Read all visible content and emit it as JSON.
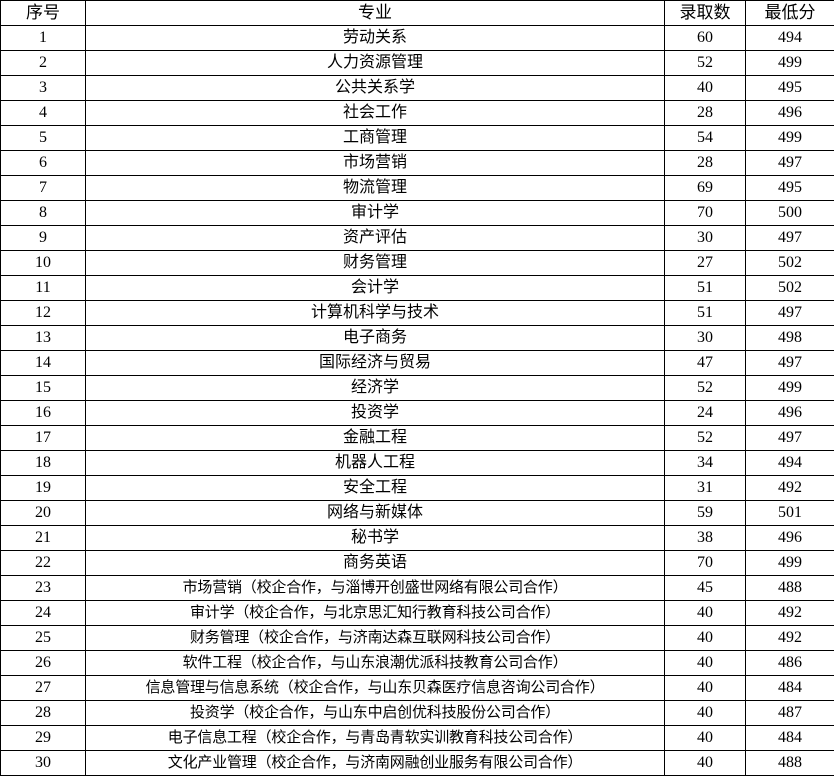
{
  "table": {
    "name": "admissions-results-table",
    "columns": [
      {
        "key": "index",
        "label": "序号"
      },
      {
        "key": "major",
        "label": "专业"
      },
      {
        "key": "count",
        "label": "录取数"
      },
      {
        "key": "score",
        "label": "最低分"
      }
    ],
    "rows": [
      {
        "index": "1",
        "major": "劳动关系",
        "count": "60",
        "score": "494"
      },
      {
        "index": "2",
        "major": "人力资源管理",
        "count": "52",
        "score": "499"
      },
      {
        "index": "3",
        "major": "公共关系学",
        "count": "40",
        "score": "495"
      },
      {
        "index": "4",
        "major": "社会工作",
        "count": "28",
        "score": "496"
      },
      {
        "index": "5",
        "major": "工商管理",
        "count": "54",
        "score": "499"
      },
      {
        "index": "6",
        "major": "市场营销",
        "count": "28",
        "score": "497"
      },
      {
        "index": "7",
        "major": "物流管理",
        "count": "69",
        "score": "495"
      },
      {
        "index": "8",
        "major": "审计学",
        "count": "70",
        "score": "500"
      },
      {
        "index": "9",
        "major": "资产评估",
        "count": "30",
        "score": "497"
      },
      {
        "index": "10",
        "major": "财务管理",
        "count": "27",
        "score": "502"
      },
      {
        "index": "11",
        "major": "会计学",
        "count": "51",
        "score": "502"
      },
      {
        "index": "12",
        "major": "计算机科学与技术",
        "count": "51",
        "score": "497"
      },
      {
        "index": "13",
        "major": "电子商务",
        "count": "30",
        "score": "498"
      },
      {
        "index": "14",
        "major": "国际经济与贸易",
        "count": "47",
        "score": "497"
      },
      {
        "index": "15",
        "major": "经济学",
        "count": "52",
        "score": "499"
      },
      {
        "index": "16",
        "major": "投资学",
        "count": "24",
        "score": "496"
      },
      {
        "index": "17",
        "major": "金融工程",
        "count": "52",
        "score": "497"
      },
      {
        "index": "18",
        "major": "机器人工程",
        "count": "34",
        "score": "494"
      },
      {
        "index": "19",
        "major": "安全工程",
        "count": "31",
        "score": "492"
      },
      {
        "index": "20",
        "major": "网络与新媒体",
        "count": "59",
        "score": "501"
      },
      {
        "index": "21",
        "major": "秘书学",
        "count": "38",
        "score": "496"
      },
      {
        "index": "22",
        "major": "商务英语",
        "count": "70",
        "score": "499"
      },
      {
        "index": "23",
        "major": "市场营销（校企合作，与淄博开创盛世网络有限公司合作）",
        "count": "45",
        "score": "488",
        "long": true
      },
      {
        "index": "24",
        "major": "审计学（校企合作，与北京思汇知行教育科技公司合作）",
        "count": "40",
        "score": "492",
        "long": true
      },
      {
        "index": "25",
        "major": "财务管理（校企合作，与济南达森互联网科技公司合作）",
        "count": "40",
        "score": "492",
        "long": true
      },
      {
        "index": "26",
        "major": "软件工程（校企合作，与山东浪潮优派科技教育公司合作）",
        "count": "40",
        "score": "486",
        "long": true
      },
      {
        "index": "27",
        "major": "信息管理与信息系统（校企合作，与山东贝森医疗信息咨询公司合作）",
        "count": "40",
        "score": "484",
        "long": true
      },
      {
        "index": "28",
        "major": "投资学（校企合作，与山东中启创优科技股份公司合作）",
        "count": "40",
        "score": "487",
        "long": true
      },
      {
        "index": "29",
        "major": "电子信息工程（校企合作，与青岛青软实训教育科技公司合作）",
        "count": "40",
        "score": "484",
        "long": true
      },
      {
        "index": "30",
        "major": "文化产业管理（校企合作，与济南网融创业服务有限公司合作）",
        "count": "40",
        "score": "488",
        "long": true
      }
    ]
  },
  "style": {
    "border_color": "#000000",
    "text_color": "#000000",
    "background": "#ffffff"
  }
}
